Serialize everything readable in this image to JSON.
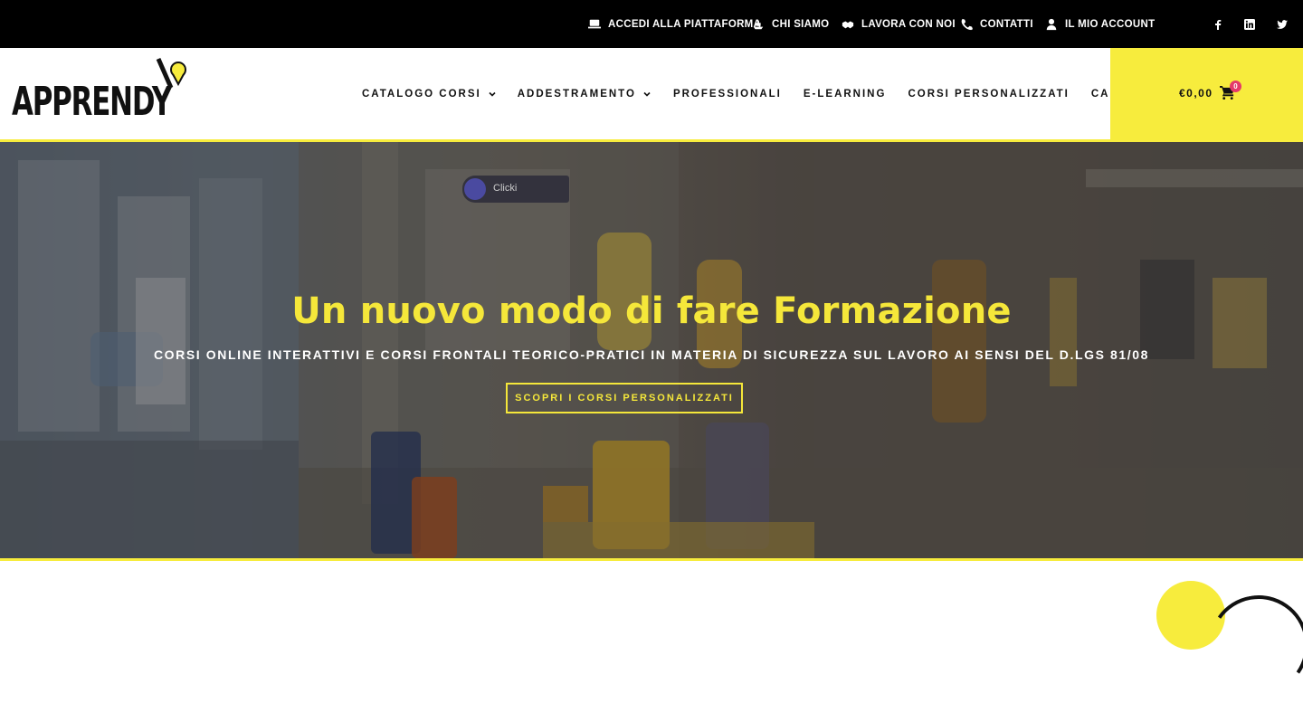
{
  "topbar": {
    "links": [
      {
        "label": "ACCEDI ALLA PIATTAFORMA",
        "icon": "laptop-icon"
      },
      {
        "label": "CHI SIAMO",
        "icon": "ship-icon"
      },
      {
        "label": "LAVORA CON NOI",
        "icon": "handshake-icon"
      },
      {
        "label": "CONTATTI",
        "icon": "phone-icon"
      },
      {
        "label": "IL MIO ACCOUNT",
        "icon": "user-icon"
      }
    ],
    "social": [
      "facebook-icon",
      "linkedin-icon",
      "twitter-icon"
    ]
  },
  "header": {
    "logo_text": "APPRENDY",
    "nav": [
      {
        "label": "CATALOGO CORSI",
        "dropdown": true
      },
      {
        "label": "ADDESTRAMENTO",
        "dropdown": true
      },
      {
        "label": "PROFESSIONALI",
        "dropdown": false
      },
      {
        "label": "E-LEARNING",
        "dropdown": false
      },
      {
        "label": "CORSI PERSONALIZZATI",
        "dropdown": false
      },
      {
        "label": "CALENDARIO",
        "dropdown": false
      }
    ],
    "cart": {
      "amount": "€0,00",
      "count": "0",
      "icon": "cart-icon"
    }
  },
  "hero": {
    "title": "Un nuovo modo di fare Formazione",
    "subtitle": "CORSI ONLINE INTERATTIVI E CORSI FRONTALI TEORICO-PRATICI IN MATERIA DI SICUREZZA SUL LAVORO AI SENSI DEL D.LGS 81/08",
    "button": "SCOPRI I CORSI PERSONALIZZATI",
    "tooltip": "Clicki"
  },
  "colors": {
    "accent": "#f7ec3d",
    "topbar": "#000000",
    "badge": "#e4396a"
  }
}
